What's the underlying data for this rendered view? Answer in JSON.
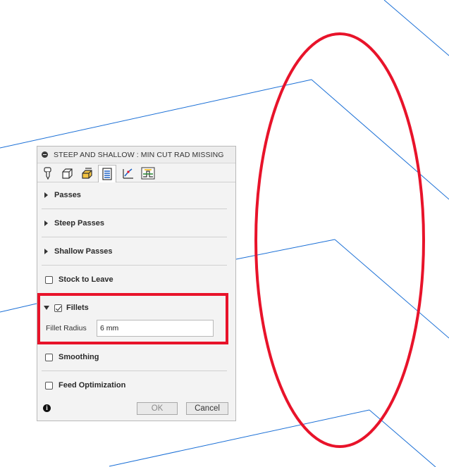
{
  "dialog": {
    "title": "STEEP AND SHALLOW : MIN CUT RAD MISSING",
    "tabs": [
      {
        "icon": "tool-icon"
      },
      {
        "icon": "geometry-icon"
      },
      {
        "icon": "heights-icon"
      },
      {
        "icon": "passes-icon",
        "active": true
      },
      {
        "icon": "linking-icon"
      },
      {
        "icon": "shape-icon"
      }
    ],
    "sections": {
      "passes": "Passes",
      "steep_passes": "Steep Passes",
      "shallow_passes": "Shallow Passes",
      "stock_to_leave": "Stock to Leave",
      "fillets": "Fillets",
      "smoothing": "Smoothing",
      "feed_optimization": "Feed Optimization"
    },
    "checkbox_states": {
      "stock_to_leave": false,
      "fillets": true,
      "smoothing": false,
      "feed_optimization": false
    },
    "fillet_radius": {
      "label": "Fillet Radius",
      "value": "6 mm"
    },
    "ok_label": "OK",
    "cancel_label": "Cancel",
    "info_symbol": "i"
  },
  "annotation_colors": {
    "highlight": "#e8132a",
    "model_lines": "#1a6fd6"
  }
}
